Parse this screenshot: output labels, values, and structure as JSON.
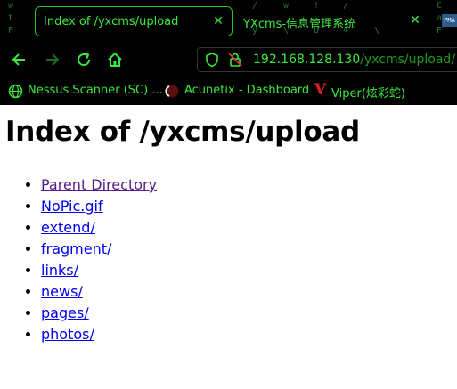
{
  "browser": {
    "tabs": [
      {
        "title": "Index of /yxcms/upload",
        "active": true
      },
      {
        "title": "YXcms-信息管理系统",
        "active": false
      }
    ],
    "address": {
      "host": "192.168.128.130",
      "path": "/yxcms/upload/"
    },
    "bookmarks": [
      {
        "label": "Nessus Scanner (SC) ...",
        "icon": "globe-icon"
      },
      {
        "label": "Acunetix - Dashboard",
        "icon": "acunetix-icon"
      },
      {
        "label": "Viper(炫彩蛇)",
        "icon": "viper-icon"
      }
    ],
    "theme": {
      "accent": "#3ce83c",
      "background": "#000000"
    }
  },
  "page": {
    "heading": "Index of /yxcms/upload",
    "entries": [
      {
        "label": "Parent Directory",
        "visited": true
      },
      {
        "label": "NoPic.gif",
        "visited": false
      },
      {
        "label": "extend/",
        "visited": false
      },
      {
        "label": "fragment/",
        "visited": false
      },
      {
        "label": "links/",
        "visited": false
      },
      {
        "label": "news/",
        "visited": false
      },
      {
        "label": "pages/",
        "visited": false
      },
      {
        "label": "photos/",
        "visited": false
      }
    ]
  }
}
